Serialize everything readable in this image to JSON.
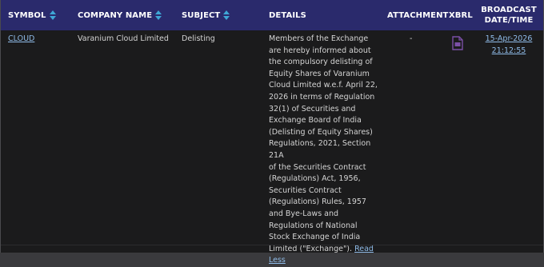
{
  "table": {
    "headers": {
      "symbol": "SYMBOL",
      "company": "COMPANY NAME",
      "subject": "SUBJECT",
      "details": "DETAILS",
      "attachment": "ATTACHMENT",
      "xbrl": "XBRL",
      "broadcast_line1": "BROADCAST",
      "broadcast_line2": "DATE/TIME"
    },
    "rows": [
      {
        "symbol": "CLOUD",
        "company": "Varanium Cloud Limited",
        "subject": "Delisting",
        "details_lines": [
          "Members of the Exchange",
          "are hereby informed about",
          "the compulsory delisting of",
          "Equity Shares of Varanium",
          "Cloud Limited w.e.f. April 22,",
          "2026 in terms of Regulation",
          "32(1) of Securities and",
          "Exchange Board of India",
          "(Delisting of Equity Shares)",
          "Regulations, 2021, Section 21A",
          "of the Securities Contract",
          "(Regulations) Act, 1956,",
          "Securities Contract",
          "(Regulations) Rules, 1957",
          "and Bye-Laws and",
          "Regulations of National",
          "Stock Exchange of India",
          "Limited (\"Exchange\")."
        ],
        "read_less_part1": "Read",
        "read_less_part2": "Less",
        "attachment": "-",
        "xbrl_icon": "xbrl-document-icon",
        "broadcast_date": "15-Apr-2026",
        "broadcast_time": "21:12:55"
      }
    ]
  },
  "colors": {
    "header_bg": "#2a2a6c",
    "body_bg": "#1b1b1c",
    "link": "#8fbbe8",
    "sort_up": "#3fa7d6",
    "sort_down": "#3fa7d6",
    "xbrl_icon": "#7b4fa6"
  }
}
